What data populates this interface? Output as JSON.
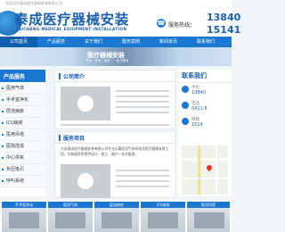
{
  "topbar": {
    "text": "欢迎访问泰成医疗器械安装有限公司"
  },
  "header": {
    "brand_cn": "泰成医疗器械安装",
    "brand_en": "TAICHENG MEDICAL EQUIPMENT INSTALLATION",
    "hotline_label": "服务热线：",
    "phone1": "13840",
    "phone2": "15141"
  },
  "nav": {
    "items": [
      "公司首页",
      "产品服务",
      "关于我们",
      "服务案例",
      "新闻资讯",
      "联系我们"
    ]
  },
  "banner": {
    "title": "医疗器械安装",
    "subtitle": "专业 · 安全 · 高效 · 一站式服务"
  },
  "sidebar": {
    "title": "产品服务",
    "items": [
      "医用气体",
      "手术室净化",
      "层流病房",
      "ICU病房",
      "医用吊塔",
      "医院改造",
      "中心供氧",
      "负压吸引",
      "呼叫系统"
    ]
  },
  "main": {
    "intro_title": "公司简介",
    "service_title": "服务项目",
    "service_text": "大连泰成医疗器械安装有限公司专业从事医用气体系统及医疗器械安装工程，为各级医院提供设计、施工、维护一站式服务。"
  },
  "contact": {
    "title": "联系我们",
    "label1": "手机",
    "val1": "13840",
    "label2": "电话",
    "val2": "0411-8",
    "label3": "邮箱",
    "val3": "1514"
  },
  "gallery": {
    "labels": [
      "手术室净化",
      "医用气体",
      "层流病房",
      "ICU病房",
      "医用吊塔"
    ]
  },
  "colors": {
    "accent": "#1a78d2",
    "brand": "#1a5fb0"
  }
}
